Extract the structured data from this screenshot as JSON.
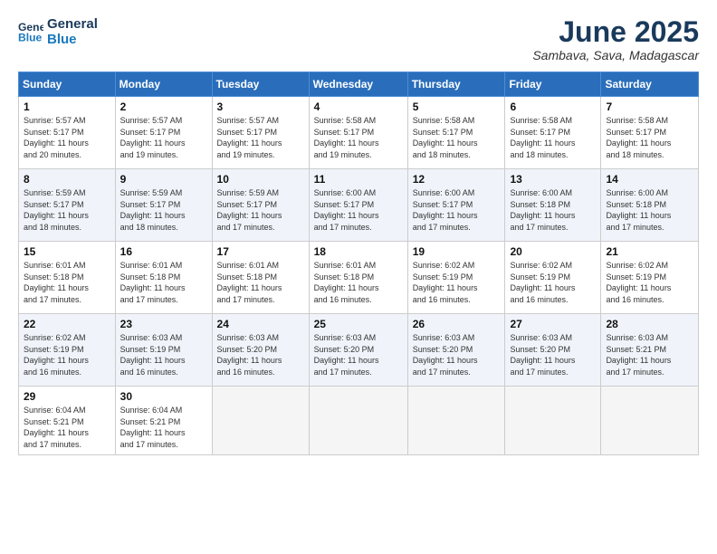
{
  "logo": {
    "line1": "General",
    "line2": "Blue"
  },
  "title": "June 2025",
  "location": "Sambava, Sava, Madagascar",
  "weekdays": [
    "Sunday",
    "Monday",
    "Tuesday",
    "Wednesday",
    "Thursday",
    "Friday",
    "Saturday"
  ],
  "weeks": [
    [
      {
        "day": "1",
        "info": "Sunrise: 5:57 AM\nSunset: 5:17 PM\nDaylight: 11 hours\nand 20 minutes."
      },
      {
        "day": "2",
        "info": "Sunrise: 5:57 AM\nSunset: 5:17 PM\nDaylight: 11 hours\nand 19 minutes."
      },
      {
        "day": "3",
        "info": "Sunrise: 5:57 AM\nSunset: 5:17 PM\nDaylight: 11 hours\nand 19 minutes."
      },
      {
        "day": "4",
        "info": "Sunrise: 5:58 AM\nSunset: 5:17 PM\nDaylight: 11 hours\nand 19 minutes."
      },
      {
        "day": "5",
        "info": "Sunrise: 5:58 AM\nSunset: 5:17 PM\nDaylight: 11 hours\nand 18 minutes."
      },
      {
        "day": "6",
        "info": "Sunrise: 5:58 AM\nSunset: 5:17 PM\nDaylight: 11 hours\nand 18 minutes."
      },
      {
        "day": "7",
        "info": "Sunrise: 5:58 AM\nSunset: 5:17 PM\nDaylight: 11 hours\nand 18 minutes."
      }
    ],
    [
      {
        "day": "8",
        "info": "Sunrise: 5:59 AM\nSunset: 5:17 PM\nDaylight: 11 hours\nand 18 minutes."
      },
      {
        "day": "9",
        "info": "Sunrise: 5:59 AM\nSunset: 5:17 PM\nDaylight: 11 hours\nand 18 minutes."
      },
      {
        "day": "10",
        "info": "Sunrise: 5:59 AM\nSunset: 5:17 PM\nDaylight: 11 hours\nand 17 minutes."
      },
      {
        "day": "11",
        "info": "Sunrise: 6:00 AM\nSunset: 5:17 PM\nDaylight: 11 hours\nand 17 minutes."
      },
      {
        "day": "12",
        "info": "Sunrise: 6:00 AM\nSunset: 5:17 PM\nDaylight: 11 hours\nand 17 minutes."
      },
      {
        "day": "13",
        "info": "Sunrise: 6:00 AM\nSunset: 5:18 PM\nDaylight: 11 hours\nand 17 minutes."
      },
      {
        "day": "14",
        "info": "Sunrise: 6:00 AM\nSunset: 5:18 PM\nDaylight: 11 hours\nand 17 minutes."
      }
    ],
    [
      {
        "day": "15",
        "info": "Sunrise: 6:01 AM\nSunset: 5:18 PM\nDaylight: 11 hours\nand 17 minutes."
      },
      {
        "day": "16",
        "info": "Sunrise: 6:01 AM\nSunset: 5:18 PM\nDaylight: 11 hours\nand 17 minutes."
      },
      {
        "day": "17",
        "info": "Sunrise: 6:01 AM\nSunset: 5:18 PM\nDaylight: 11 hours\nand 17 minutes."
      },
      {
        "day": "18",
        "info": "Sunrise: 6:01 AM\nSunset: 5:18 PM\nDaylight: 11 hours\nand 16 minutes."
      },
      {
        "day": "19",
        "info": "Sunrise: 6:02 AM\nSunset: 5:19 PM\nDaylight: 11 hours\nand 16 minutes."
      },
      {
        "day": "20",
        "info": "Sunrise: 6:02 AM\nSunset: 5:19 PM\nDaylight: 11 hours\nand 16 minutes."
      },
      {
        "day": "21",
        "info": "Sunrise: 6:02 AM\nSunset: 5:19 PM\nDaylight: 11 hours\nand 16 minutes."
      }
    ],
    [
      {
        "day": "22",
        "info": "Sunrise: 6:02 AM\nSunset: 5:19 PM\nDaylight: 11 hours\nand 16 minutes."
      },
      {
        "day": "23",
        "info": "Sunrise: 6:03 AM\nSunset: 5:19 PM\nDaylight: 11 hours\nand 16 minutes."
      },
      {
        "day": "24",
        "info": "Sunrise: 6:03 AM\nSunset: 5:20 PM\nDaylight: 11 hours\nand 16 minutes."
      },
      {
        "day": "25",
        "info": "Sunrise: 6:03 AM\nSunset: 5:20 PM\nDaylight: 11 hours\nand 17 minutes."
      },
      {
        "day": "26",
        "info": "Sunrise: 6:03 AM\nSunset: 5:20 PM\nDaylight: 11 hours\nand 17 minutes."
      },
      {
        "day": "27",
        "info": "Sunrise: 6:03 AM\nSunset: 5:20 PM\nDaylight: 11 hours\nand 17 minutes."
      },
      {
        "day": "28",
        "info": "Sunrise: 6:03 AM\nSunset: 5:21 PM\nDaylight: 11 hours\nand 17 minutes."
      }
    ],
    [
      {
        "day": "29",
        "info": "Sunrise: 6:04 AM\nSunset: 5:21 PM\nDaylight: 11 hours\nand 17 minutes."
      },
      {
        "day": "30",
        "info": "Sunrise: 6:04 AM\nSunset: 5:21 PM\nDaylight: 11 hours\nand 17 minutes."
      },
      {
        "day": "",
        "info": ""
      },
      {
        "day": "",
        "info": ""
      },
      {
        "day": "",
        "info": ""
      },
      {
        "day": "",
        "info": ""
      },
      {
        "day": "",
        "info": ""
      }
    ]
  ]
}
